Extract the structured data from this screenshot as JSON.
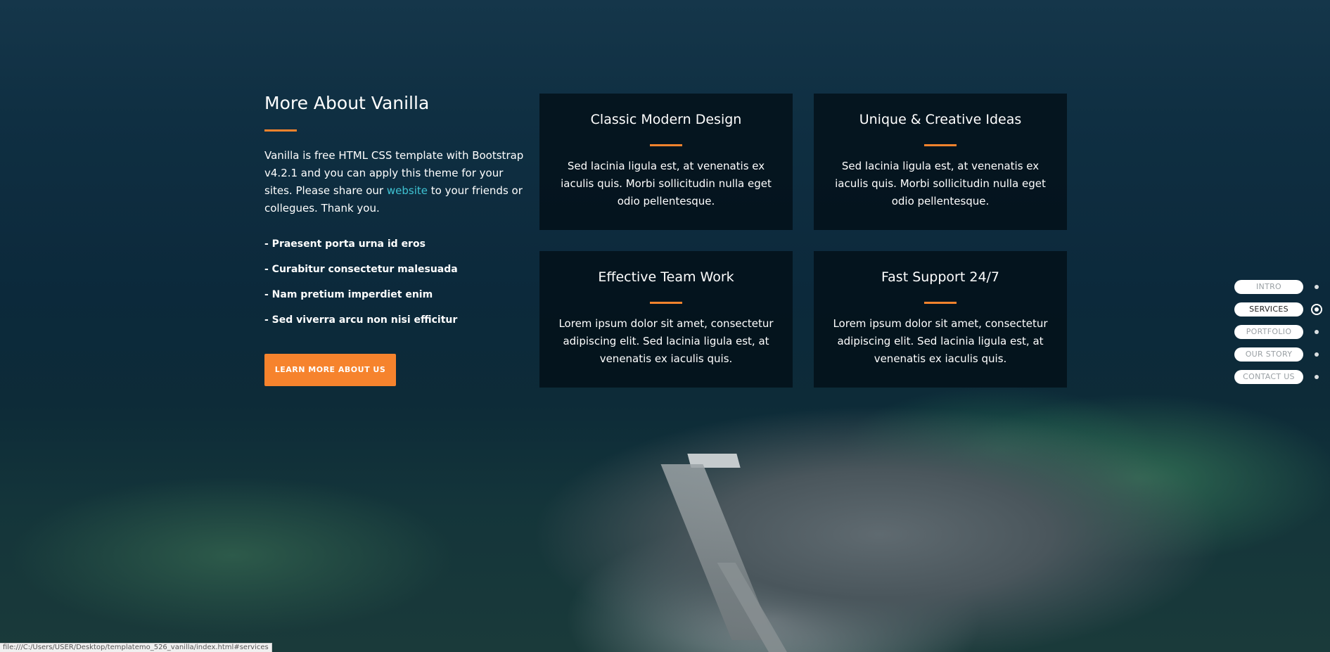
{
  "about": {
    "title": "More About Vanilla",
    "paragraph_before_link": "Vanilla is free HTML CSS template with Bootstrap v4.2.1 and you can apply this theme for your sites. Please share our ",
    "link_text": "website",
    "paragraph_after_link": " to your friends or collegues. Thank you.",
    "list": [
      "- Praesent porta urna id eros",
      "- Curabitur consectetur malesuada",
      "- Nam pretium imperdiet enim",
      "- Sed viverra arcu non nisi efficitur"
    ],
    "button_label": "LEARN MORE ABOUT US"
  },
  "cards": [
    {
      "title": "Classic Modern Design",
      "text": "Sed lacinia ligula est, at venenatis ex iaculis quis. Morbi sollicitudin nulla eget odio pellentesque."
    },
    {
      "title": "Unique & Creative Ideas",
      "text": "Sed lacinia ligula est, at venenatis ex iaculis quis. Morbi sollicitudin nulla eget odio pellentesque."
    },
    {
      "title": "Effective Team Work",
      "text": "Lorem ipsum dolor sit amet, consectetur adipiscing elit. Sed lacinia ligula est, at venenatis ex iaculis quis."
    },
    {
      "title": "Fast Support 24/7",
      "text": "Lorem ipsum dolor sit amet, consectetur adipiscing elit. Sed lacinia ligula est, at venenatis ex iaculis quis."
    }
  ],
  "nav": [
    {
      "label": "INTRO",
      "active": false
    },
    {
      "label": "SERVICES",
      "active": true
    },
    {
      "label": "PORTFOLIO",
      "active": false
    },
    {
      "label": "OUR STORY",
      "active": false
    },
    {
      "label": "CONTACT US",
      "active": false
    }
  ],
  "status_url": "file:///C:/Users/USER/Desktop/templatemo_526_vanilla/index.html#services",
  "colors": {
    "accent": "#f6832d",
    "link": "#3fc3d3",
    "card_bg": "rgba(3, 14, 22, 0.78)"
  }
}
